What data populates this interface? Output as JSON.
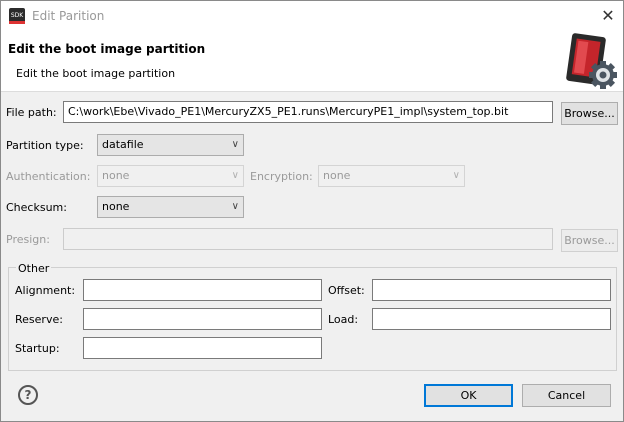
{
  "window": {
    "title": "Edit Parition",
    "app_badge": "SDK",
    "close_glyph": "✕"
  },
  "header": {
    "title": "Edit the boot image partition",
    "subtitle": "Edit the boot image partition"
  },
  "file_path": {
    "label": "File path:",
    "value": "C:\\work\\Ebe\\Vivado_PE1\\MercuryZX5_PE1.runs\\MercuryPE1_impl\\system_top.bit",
    "browse_label": "Browse..."
  },
  "partition_type": {
    "label": "Partition type:",
    "value": "datafile"
  },
  "authentication": {
    "label": "Authentication:",
    "value": "none"
  },
  "encryption": {
    "label": "Encryption:",
    "value": "none"
  },
  "checksum": {
    "label": "Checksum:",
    "value": "none"
  },
  "presign": {
    "label": "Presign:",
    "value": "",
    "browse_label": "Browse..."
  },
  "other": {
    "title": "Other",
    "alignment_label": "Alignment:",
    "alignment_value": "",
    "offset_label": "Offset:",
    "offset_value": "",
    "reserve_label": "Reserve:",
    "reserve_value": "",
    "load_label": "Load:",
    "load_value": "",
    "startup_label": "Startup:",
    "startup_value": ""
  },
  "footer": {
    "help_glyph": "?",
    "ok_label": "OK",
    "cancel_label": "Cancel"
  },
  "icons": {
    "combo_chevron": "chevron-down-icon",
    "header": "boot-image-gear-icon"
  },
  "colors": {
    "default_button_border": "#0078d7",
    "disabled_text": "#9a9a9a"
  }
}
